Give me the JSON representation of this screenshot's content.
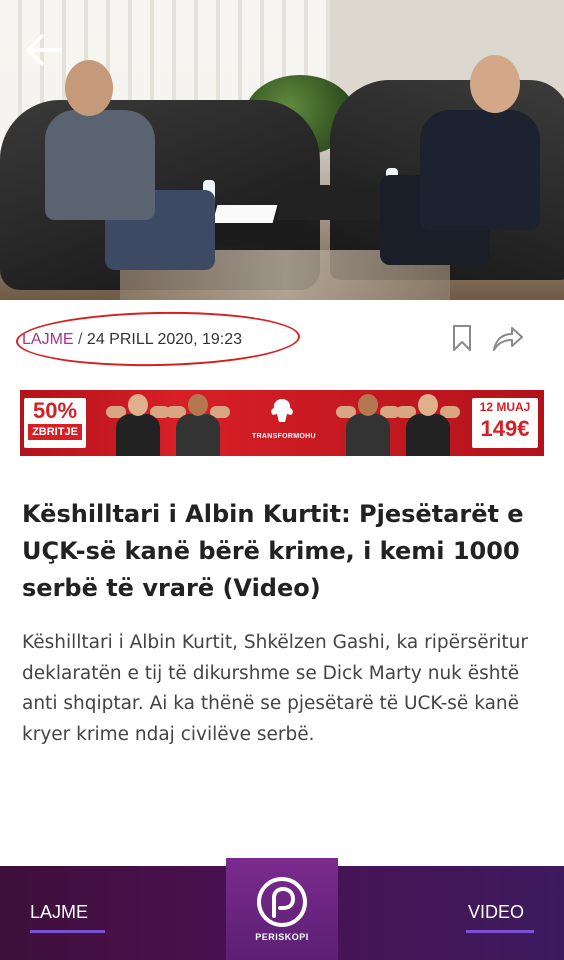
{
  "article": {
    "category": "LAJME",
    "separator": " / ",
    "date": "24 PRILL 2020, 19:23",
    "headline": "Këshilltari i Albin Kurtit: Pjesëtarët e UÇK-së kanë bërë krime, i kemi 1000 serbë të vrarë (Video)",
    "lead": "Këshilltari i Albin Kurtit, Shkëlzen Gashi, ka ripërsëritur deklaratën e tij të dikurshme se Dick Marty nuk është anti shqiptar. Ai ka thënë se pjesëtarë të UCK-së kanë kryer krime ndaj civilëve serbë."
  },
  "ad": {
    "discount": "50%",
    "discount_label": "ZBRITJE",
    "brand": "TRANSFORMOHU",
    "term": "12 MUAJ",
    "price": "149€"
  },
  "nav": {
    "left_label": "LAJME",
    "center_label": "PERISKOPI",
    "right_label": "VIDEO"
  },
  "icons": {
    "back": "back-arrow-icon",
    "bookmark": "bookmark-icon",
    "share": "share-icon",
    "logo": "periskopi-logo-icon"
  },
  "colors": {
    "category": "#a9338f",
    "annotation": "#d71f1f",
    "ad_red": "#d71f26",
    "nav_bg": "#4a1150",
    "nav_center": "#7b2b8d",
    "nav_underline": "#7a4fd0"
  }
}
